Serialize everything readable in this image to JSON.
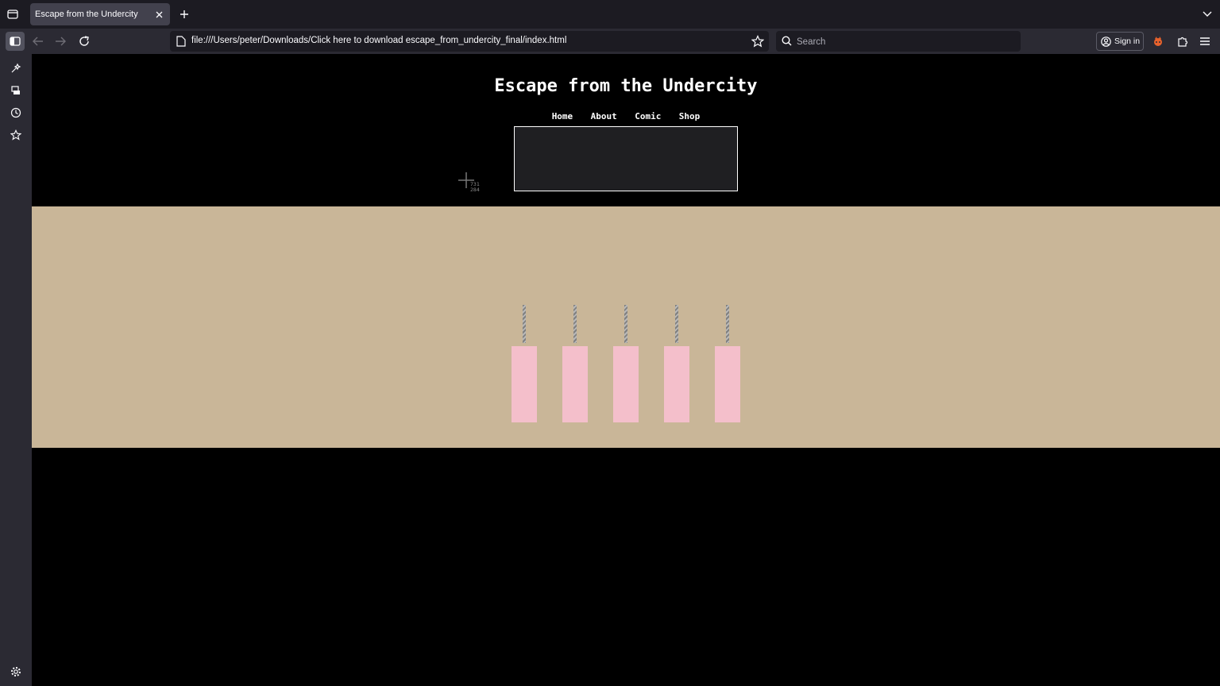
{
  "browser": {
    "tab": {
      "title": "Escape from the Undercity"
    },
    "url": "file:///Users/peter/Downloads/Click here to download escape_from_undercity_final/index.html",
    "search": {
      "placeholder": "Search"
    },
    "signin_label": "Sign in",
    "colors": {
      "tabstrip": "#1c1b22",
      "toolbar": "#2b2a33",
      "tab_active": "#42414d"
    }
  },
  "site": {
    "title": "Escape from the Undercity",
    "nav": [
      "Home",
      "About",
      "Comic",
      "Shop"
    ],
    "colors": {
      "background": "#000000",
      "band": "#c9b698",
      "candle": "#f4bfcb"
    },
    "candle_count": 5
  },
  "cursor_readout": {
    "x": "731",
    "y": "284"
  }
}
